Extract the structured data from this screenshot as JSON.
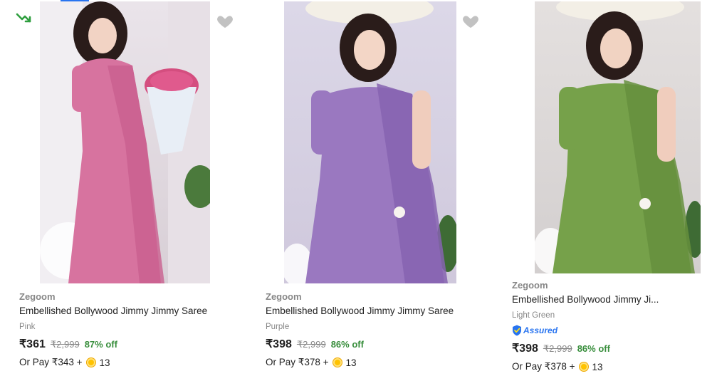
{
  "colors": {
    "price_discount": "#388e3c",
    "muted": "#878787",
    "assured_blue": "#2874f0",
    "coin": "#ffc200"
  },
  "products": [
    {
      "brand": "Zegoom",
      "title": "Embellished Bollywood Jimmy Jimmy Saree",
      "variant": "Pink",
      "price": "₹361",
      "mrp": "₹2,999",
      "discount": "87% off",
      "pay_text": "Or Pay ₹343 +",
      "coins": "13",
      "saree_color": "#d7739f",
      "assured": false
    },
    {
      "brand": "Zegoom",
      "title": "Embellished Bollywood Jimmy Jimmy Saree",
      "variant": "Purple",
      "price": "₹398",
      "mrp": "₹2,999",
      "discount": "86% off",
      "pay_text": "Or Pay ₹378 +",
      "coins": "13",
      "saree_color": "#9a78c0",
      "assured": false
    },
    {
      "brand": "Zegoom",
      "title": "Embellished Bollywood Jimmy Ji...",
      "variant": "Light Green",
      "assured_label": "Assured",
      "price": "₹398",
      "mrp": "₹2,999",
      "discount": "86% off",
      "pay_text": "Or Pay ₹378 +",
      "coins": "13",
      "saree_color": "#76a14a",
      "assured": true
    }
  ],
  "icons": {
    "trend": "trending-down-icon",
    "wishlist": "heart-icon",
    "coin": "supercoin-icon",
    "assured": "assured-shield-icon"
  }
}
